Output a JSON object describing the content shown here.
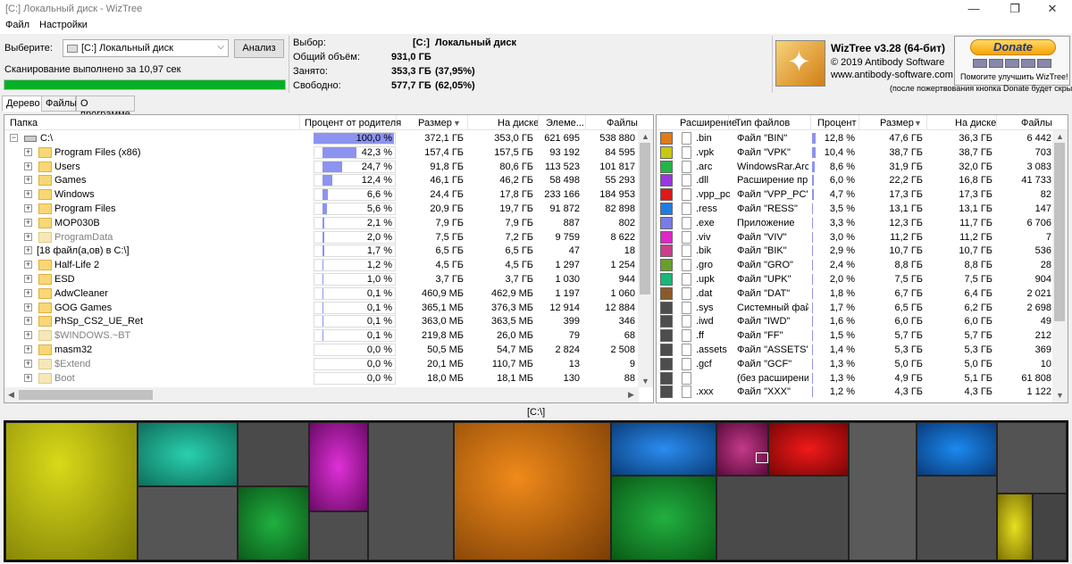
{
  "window": {
    "title": "[C:] Локальный диск  - WizTree",
    "minimize": "—",
    "maximize": "❐",
    "close": "✕"
  },
  "menu": {
    "file": "Файл",
    "settings": "Настройки"
  },
  "scan": {
    "select_label": "Выберите:",
    "drive_value": "[C:] Локальный диск",
    "analyze_button": "Анализ",
    "status": "Сканирование выполнено за 10,97 сек",
    "progress_pct": 100
  },
  "info": {
    "selection_label": "Выбор:",
    "selection_drive": "[C:]",
    "selection_name": "Локальный диск",
    "total_label": "Общий объём:",
    "total_value": "931,0 ГБ",
    "used_label": "Занято:",
    "used_value": "353,3 ГБ",
    "used_pct": "(37,95%)",
    "free_label": "Свободно:",
    "free_value": "577,7 ГБ",
    "free_pct": "(62,05%)"
  },
  "about": {
    "title": "WizTree v3.28 (64-бит)",
    "copyright": "© 2019 Antibody Software",
    "url": "www.antibody-software.com"
  },
  "donate": {
    "button": "Donate",
    "text": "Помогите улучшить WizTree!",
    "note": "(после пожертвования кнопка Donate будет скрыта)"
  },
  "tabs": [
    "Дерево",
    "Файлы",
    "О программе"
  ],
  "tree": {
    "columns": [
      "Папка",
      "Процент от родителя",
      "Размер",
      "На диске",
      "Элеме...",
      "Файлы"
    ],
    "rows": [
      {
        "name": "C:\\",
        "pct": "100,0 %",
        "pctv": 100,
        "size": "372,1 ГБ",
        "disk": "353,0 ГБ",
        "items": "621 695",
        "files": "538 880",
        "level": 0,
        "icon": "drive"
      },
      {
        "name": "Program Files (x86)",
        "pct": "42,3 %",
        "pctv": 42.3,
        "size": "157,4 ГБ",
        "disk": "157,5 ГБ",
        "items": "93 192",
        "files": "84 595",
        "level": 1,
        "icon": "folder"
      },
      {
        "name": "Users",
        "pct": "24,7 %",
        "pctv": 24.7,
        "size": "91,8 ГБ",
        "disk": "80,6 ГБ",
        "items": "113 523",
        "files": "101 817",
        "level": 1,
        "icon": "folder"
      },
      {
        "name": "Games",
        "pct": "12,4 %",
        "pctv": 12.4,
        "size": "46,1 ГБ",
        "disk": "46,2 ГБ",
        "items": "58 498",
        "files": "55 293",
        "level": 1,
        "icon": "folder"
      },
      {
        "name": "Windows",
        "pct": "6,6 %",
        "pctv": 6.6,
        "size": "24,4 ГБ",
        "disk": "17,8 ГБ",
        "items": "233 166",
        "files": "184 953",
        "level": 1,
        "icon": "folder"
      },
      {
        "name": "Program Files",
        "pct": "5,6 %",
        "pctv": 5.6,
        "size": "20,9 ГБ",
        "disk": "19,7 ГБ",
        "items": "91 872",
        "files": "82 898",
        "level": 1,
        "icon": "folder"
      },
      {
        "name": "MOP030B",
        "pct": "2,1 %",
        "pctv": 2.1,
        "size": "7,9 ГБ",
        "disk": "7,9 ГБ",
        "items": "887",
        "files": "802",
        "level": 1,
        "icon": "folder"
      },
      {
        "name": "ProgramData",
        "pct": "2,0 %",
        "pctv": 2.0,
        "size": "7,5 ГБ",
        "disk": "7,2 ГБ",
        "items": "9 759",
        "files": "8 622",
        "level": 1,
        "icon": "folder-grey",
        "grey": true
      },
      {
        "name": "[18 файл(а,ов) в C:\\]",
        "pct": "1,7 %",
        "pctv": 1.7,
        "size": "6,5 ГБ",
        "disk": "6,5 ГБ",
        "items": "47",
        "files": "18",
        "level": 1,
        "icon": "none"
      },
      {
        "name": "Half-Life 2",
        "pct": "1,2 %",
        "pctv": 1.2,
        "size": "4,5 ГБ",
        "disk": "4,5 ГБ",
        "items": "1 297",
        "files": "1 254",
        "level": 1,
        "icon": "folder"
      },
      {
        "name": "ESD",
        "pct": "1,0 %",
        "pctv": 1.0,
        "size": "3,7 ГБ",
        "disk": "3,7 ГБ",
        "items": "1 030",
        "files": "944",
        "level": 1,
        "icon": "folder"
      },
      {
        "name": "AdwCleaner",
        "pct": "0,1 %",
        "pctv": 0.1,
        "size": "460,9 МБ",
        "disk": "462,9 МБ",
        "items": "1 197",
        "files": "1 060",
        "level": 1,
        "icon": "folder"
      },
      {
        "name": "GOG Games",
        "pct": "0,1 %",
        "pctv": 0.1,
        "size": "365,1 МБ",
        "disk": "376,3 МБ",
        "items": "12 914",
        "files": "12 884",
        "level": 1,
        "icon": "folder"
      },
      {
        "name": "PhSp_CS2_UE_Ret",
        "pct": "0,1 %",
        "pctv": 0.1,
        "size": "363,0 МБ",
        "disk": "363,5 МБ",
        "items": "399",
        "files": "346",
        "level": 1,
        "icon": "folder"
      },
      {
        "name": "$WINDOWS.~BT",
        "pct": "0,1 %",
        "pctv": 0.1,
        "size": "219,8 МБ",
        "disk": "26,0 МБ",
        "items": "79",
        "files": "68",
        "level": 1,
        "icon": "folder-grey",
        "grey": true
      },
      {
        "name": "masm32",
        "pct": "0,0 %",
        "pctv": 0,
        "size": "50,5 МБ",
        "disk": "54,7 МБ",
        "items": "2 824",
        "files": "2 508",
        "level": 1,
        "icon": "folder"
      },
      {
        "name": "$Extend",
        "pct": "0,0 %",
        "pctv": 0,
        "size": "20,1 МБ",
        "disk": "110,7 МБ",
        "items": "13",
        "files": "9",
        "level": 1,
        "icon": "folder-sys",
        "grey": true
      },
      {
        "name": "Boot",
        "pct": "0,0 %",
        "pctv": 0,
        "size": "18,0 МБ",
        "disk": "18,1 МБ",
        "items": "130",
        "files": "88",
        "level": 1,
        "icon": "folder-sys",
        "grey": true
      }
    ]
  },
  "types": {
    "columns": [
      "Расширение",
      "Тип файлов",
      "Процент",
      "Размер",
      "На диске",
      "Файлы"
    ],
    "rows": [
      {
        "color": "#e07b17",
        "ext": ".bin",
        "type": "Файл \"BIN\"",
        "pct": "12,8 %",
        "pctv": 12.8,
        "size": "47,6 ГБ",
        "disk": "36,3 ГБ",
        "files": "6 442"
      },
      {
        "color": "#c8c814",
        "ext": ".vpk",
        "type": "Файл \"VPK\"",
        "pct": "10,4 %",
        "pctv": 10.4,
        "size": "38,7 ГБ",
        "disk": "38,7 ГБ",
        "files": "703"
      },
      {
        "color": "#22b548",
        "ext": ".arc",
        "type": "WindowsRar.Arch",
        "pct": "8,6 %",
        "pctv": 8.6,
        "size": "31,9 ГБ",
        "disk": "32,0 ГБ",
        "files": "3 083"
      },
      {
        "color": "#9b36e0",
        "ext": ".dll",
        "type": "Расширение прил",
        "pct": "6,0 %",
        "pctv": 6.0,
        "size": "22,2 ГБ",
        "disk": "16,8 ГБ",
        "files": "41 733"
      },
      {
        "color": "#e01818",
        "ext": ".vpp_pc",
        "type": "Файл \"VPP_PC\"",
        "pct": "4,7 %",
        "pctv": 4.7,
        "size": "17,3 ГБ",
        "disk": "17,3 ГБ",
        "files": "82"
      },
      {
        "color": "#1e7ee0",
        "ext": ".ress",
        "type": "Файл \"RESS\"",
        "pct": "3,5 %",
        "pctv": 3.5,
        "size": "13,1 ГБ",
        "disk": "13,1 ГБ",
        "files": "147"
      },
      {
        "color": "#7a7ae8",
        "ext": ".exe",
        "type": "Приложение",
        "pct": "3,3 %",
        "pctv": 3.3,
        "size": "12,3 ГБ",
        "disk": "11,7 ГБ",
        "files": "6 706"
      },
      {
        "color": "#e026c8",
        "ext": ".viv",
        "type": "Файл \"VIV\"",
        "pct": "3,0 %",
        "pctv": 3.0,
        "size": "11,2 ГБ",
        "disk": "11,2 ГБ",
        "files": "7"
      },
      {
        "color": "#cc3d8c",
        "ext": ".bik",
        "type": "Файл \"BIK\"",
        "pct": "2,9 %",
        "pctv": 2.9,
        "size": "10,7 ГБ",
        "disk": "10,7 ГБ",
        "files": "536"
      },
      {
        "color": "#6a9e2c",
        "ext": ".gro",
        "type": "Файл \"GRO\"",
        "pct": "2,4 %",
        "pctv": 2.4,
        "size": "8,8 ГБ",
        "disk": "8,8 ГБ",
        "files": "28"
      },
      {
        "color": "#18b87a",
        "ext": ".upk",
        "type": "Файл \"UPK\"",
        "pct": "2,0 %",
        "pctv": 2.0,
        "size": "7,5 ГБ",
        "disk": "7,5 ГБ",
        "files": "904"
      },
      {
        "color": "#8c5a28",
        "ext": ".dat",
        "type": "Файл \"DAT\"",
        "pct": "1,8 %",
        "pctv": 1.8,
        "size": "6,7 ГБ",
        "disk": "6,4 ГБ",
        "files": "2 021"
      },
      {
        "color": "#4d4d4d",
        "ext": ".sys",
        "type": "Системный файл",
        "pct": "1,7 %",
        "pctv": 1.7,
        "size": "6,5 ГБ",
        "disk": "6,2 ГБ",
        "files": "2 698"
      },
      {
        "color": "#4d4d4d",
        "ext": ".iwd",
        "type": "Файл \"IWD\"",
        "pct": "1,6 %",
        "pctv": 1.6,
        "size": "6,0 ГБ",
        "disk": "6,0 ГБ",
        "files": "49"
      },
      {
        "color": "#4d4d4d",
        "ext": ".ff",
        "type": "Файл \"FF\"",
        "pct": "1,5 %",
        "pctv": 1.5,
        "size": "5,7 ГБ",
        "disk": "5,7 ГБ",
        "files": "212"
      },
      {
        "color": "#4d4d4d",
        "ext": ".assets",
        "type": "Файл \"ASSETS\"",
        "pct": "1,4 %",
        "pctv": 1.4,
        "size": "5,3 ГБ",
        "disk": "5,3 ГБ",
        "files": "369"
      },
      {
        "color": "#4d4d4d",
        "ext": ".gcf",
        "type": "Файл \"GCF\"",
        "pct": "1,3 %",
        "pctv": 1.3,
        "size": "5,0 ГБ",
        "disk": "5,0 ГБ",
        "files": "10"
      },
      {
        "color": "#4d4d4d",
        "ext": "",
        "type": "(без расширения)",
        "pct": "1,3 %",
        "pctv": 1.3,
        "size": "4,9 ГБ",
        "disk": "5,1 ГБ",
        "files": "61 808"
      },
      {
        "color": "#4d4d4d",
        "ext": ".xxx",
        "type": "Файл \"XXX\"",
        "pct": "1,2 %",
        "pctv": 1.2,
        "size": "4,3 ГБ",
        "disk": "4,3 ГБ",
        "files": "1 122"
      }
    ]
  },
  "treemap": {
    "path": "[C:\\]"
  }
}
